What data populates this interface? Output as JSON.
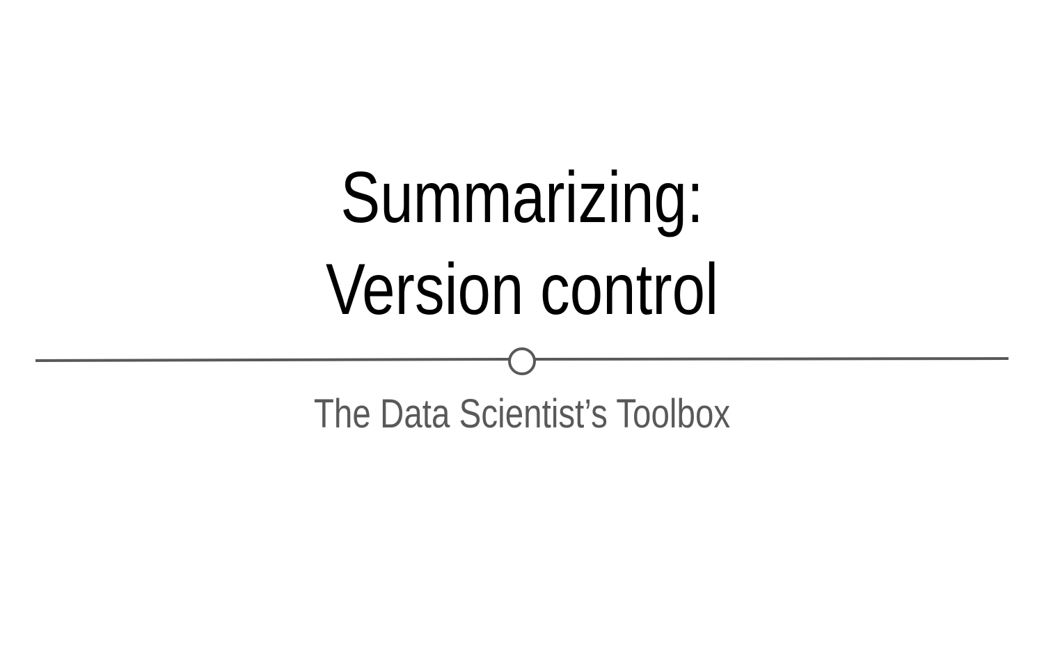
{
  "slide": {
    "title_line1": "Summarizing:",
    "title_line2": "Version control",
    "subtitle": "The Data Scientist’s Toolbox"
  },
  "colors": {
    "title": "#000000",
    "subtitle": "#595959",
    "divider": "#595959",
    "background": "#ffffff"
  }
}
